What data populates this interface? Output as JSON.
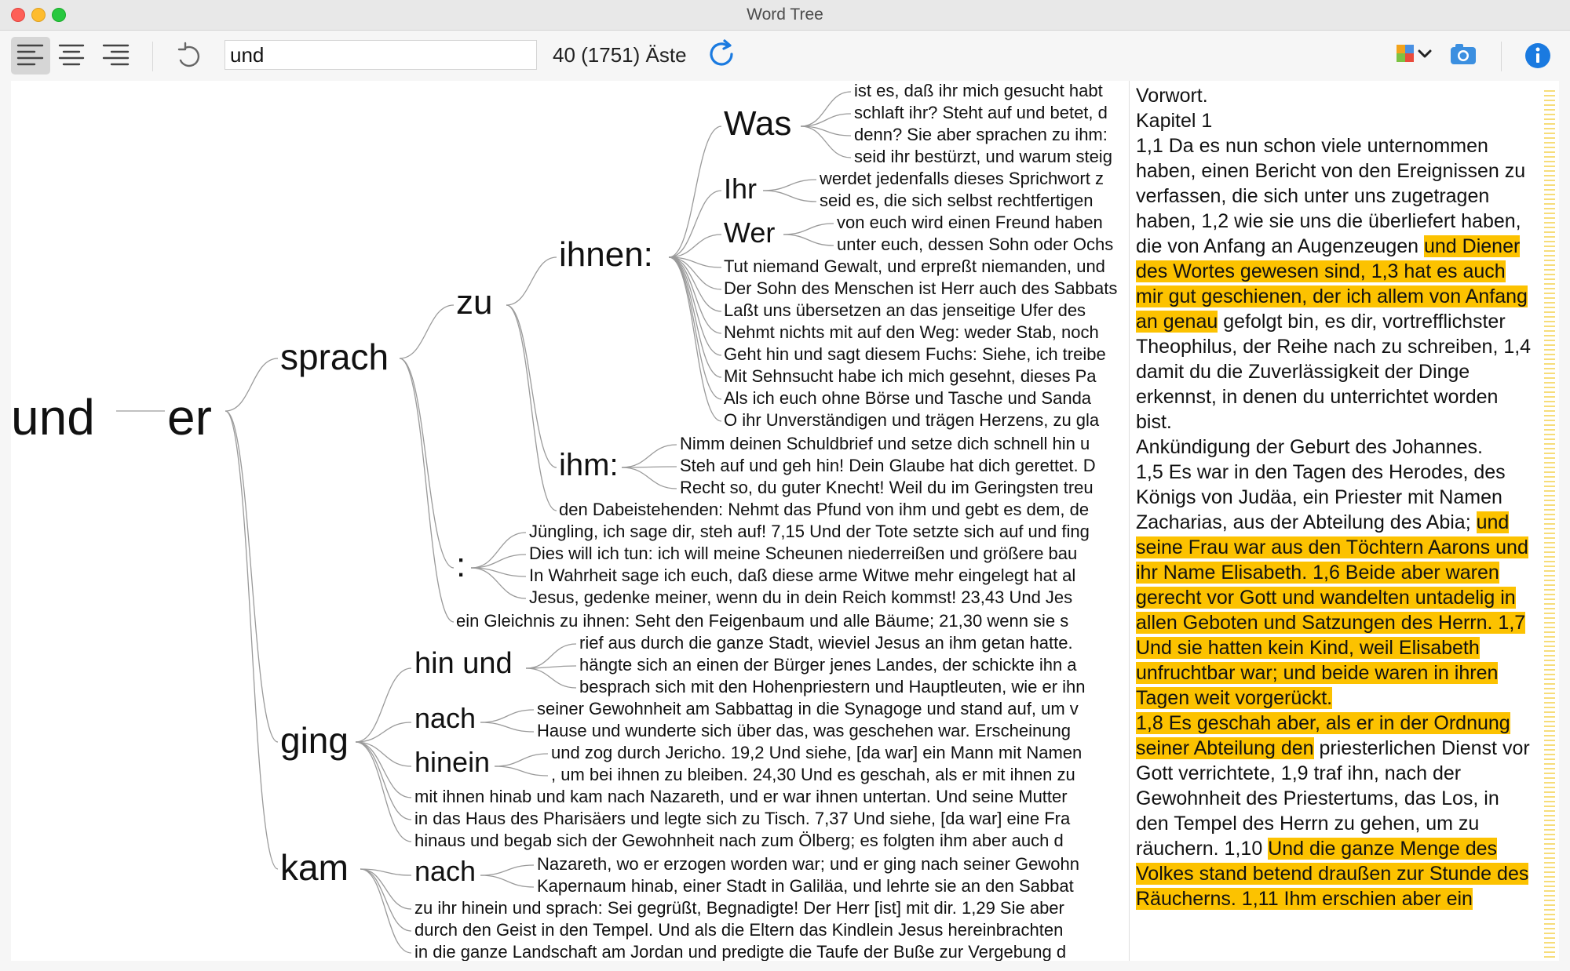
{
  "window": {
    "title": "Word Tree"
  },
  "toolbar": {
    "search_value": "und",
    "search_placeholder": "",
    "branches_label": "40 (1751) Äste",
    "icons": [
      "align-left-icon",
      "align-center-icon",
      "align-right-icon",
      "undo-icon",
      "refresh-icon",
      "plugin-icon",
      "chevron-down-icon",
      "camera-icon",
      "info-icon"
    ],
    "accent_color": "#1a7ae0"
  },
  "tree": {
    "root": "und",
    "level1": "er",
    "sprach": "sprach",
    "ging": "ging",
    "kam": "kam",
    "zu": "zu",
    "colon": ":",
    "ihnen": "ihnen:",
    "ihm": "ihm:",
    "was": "Was",
    "ihr": "Ihr",
    "wer": "Wer",
    "hin_und": "hin und",
    "nach_ging": "nach",
    "hinein": "hinein",
    "nach_kam": "nach",
    "leaves_was": [
      "ist es, daß ihr mich gesucht habt",
      "schlaft ihr? Steht auf und betet, d",
      "denn? Sie aber sprachen zu ihm:",
      "seid ihr bestürzt, und warum steig"
    ],
    "leaves_ihr": [
      "werdet jedenfalls dieses Sprichwort z",
      "seid es, die sich selbst rechtfertigen"
    ],
    "leaves_wer": [
      "von euch wird einen Freund haben",
      "unter euch, dessen Sohn oder Ochs"
    ],
    "leaves_ihnen": [
      "Tut niemand Gewalt, und erpreßt niemanden, und",
      "Der Sohn des Menschen ist Herr auch des Sabbats",
      "Laßt uns übersetzen an das jenseitige Ufer des",
      "Nehmt nichts mit auf den Weg: weder Stab, noch",
      "Geht hin und sagt diesem Fuchs: Siehe, ich treibe",
      "Mit Sehnsucht habe ich mich gesehnt, dieses Pa",
      "Als ich euch ohne Börse und Tasche und Sanda",
      "O ihr Unverständigen und trägen Herzens, zu gla"
    ],
    "leaves_ihm": [
      "Nimm deinen Schuldbrief und setze dich schnell hin u",
      "Steh auf und geh hin! Dein Glaube hat dich gerettet. D",
      "Recht so, du guter Knecht! Weil du im Geringsten treu"
    ],
    "leaf_dabei": "den Dabeistehenden: Nehmt das Pfund von ihm und gebt es dem, de",
    "leaves_colon": [
      "Jüngling, ich sage dir, steh auf! 7,15 Und der Tote setzte sich auf und fing",
      "Dies will ich tun: ich will meine Scheunen niederreißen und größere bau",
      "In Wahrheit sage ich euch, daß diese arme Witwe mehr eingelegt hat al",
      "Jesus, gedenke meiner, wenn du in dein Reich kommst! 23,43 Und Jes"
    ],
    "leaf_gleichnis": "ein Gleichnis zu ihnen: Seht den Feigenbaum und alle Bäume; 21,30 wenn sie s",
    "leaves_hin_und": [
      "rief aus durch die ganze Stadt, wieviel Jesus an ihm getan hatte.",
      "hängte sich an einen der Bürger jenes Landes, der schickte ihn a",
      "besprach sich mit den Hohenpriestern und Hauptleuten, wie er ihn"
    ],
    "leaves_nach_ging": [
      "seiner Gewohnheit am Sabbattag in die Synagoge und stand auf, um v",
      "Hause und wunderte sich über das, was geschehen war. Erscheinung"
    ],
    "leaves_hinein": [
      "und zog durch Jericho. 19,2 Und siehe, [da war] ein Mann mit Namen",
      ", um bei ihnen zu bleiben. 24,30 Und es geschah, als er mit ihnen zu"
    ],
    "leaves_ging": [
      "mit ihnen hinab und kam nach Nazareth, und er war ihnen untertan. Und seine Mutter",
      "in das Haus des Pharisäers und legte sich zu Tisch. 7,37 Und siehe, [da war] eine Fra",
      "hinaus und begab sich der Gewohnheit nach zum Ölberg; es folgten ihm aber auch d"
    ],
    "leaves_nach_kam": [
      "Nazareth, wo er erzogen worden war; und er ging nach seiner Gewohn",
      "Kapernaum hinab, einer Stadt in Galiläa, und lehrte sie an den Sabbat"
    ],
    "leaves_kam": [
      "zu ihr hinein und sprach: Sei gegrüßt, Begnadigte! Der Herr [ist] mit dir. 1,29 Sie aber",
      "durch den Geist in den Tempel. Und als die Eltern das Kindlein Jesus hereinbrachten",
      "in die ganze Landschaft am Jordan und predigte die Taufe der Buße zur Vergebung d"
    ]
  },
  "reader": {
    "highlight_color": "#fcc200",
    "segments": [
      {
        "t": "Vorwort.",
        "h": false,
        "br": true
      },
      {
        "t": "Kapitel 1",
        "h": false,
        "br": true
      },
      {
        "t": "1,1 Da es nun schon viele unternommen haben, einen Bericht von den Ereignissen zu verfassen, die sich unter uns zugetragen haben, 1,2 wie sie uns die überliefert haben, die von Anfang an Augenzeugen ",
        "h": false
      },
      {
        "t": "und Diener des Wortes gewesen sind, 1,3 hat es auch mir gut geschienen, der ich allem von Anfang an genau",
        "h": true
      },
      {
        "t": " gefolgt bin, es dir, vortrefflichster Theophilus, der Reihe nach zu schreiben, 1,4 damit du die Zuverlässigkeit der Dinge erkennst, in denen du unterrichtet worden bist.",
        "h": false,
        "br": true
      },
      {
        "t": "Ankündigung der Geburt des Johannes.",
        "h": false,
        "br": true
      },
      {
        "t": "1,5 Es war in den Tagen des Herodes, des Königs von Judäa, ein Priester mit Namen Zacharias, aus der Abteilung des Abia; ",
        "h": false
      },
      {
        "t": "und seine Frau war aus den Töchtern Aarons und ihr Name Elisabeth. 1,6 Beide aber waren gerecht vor Gott und wandelten untadelig in allen Geboten und Satzungen des Herrn. 1,7 Und sie hatten kein Kind, weil Elisabeth unfruchtbar war; und beide waren in ihren Tagen weit vorgerückt. ",
        "h": true,
        "br": true
      },
      {
        "t": "1,8 Es geschah aber, als er in der Ordnung seiner Abteilung den",
        "h": true
      },
      {
        "t": " priesterlichen Dienst vor Gott verrichtete, 1,9 traf ihn, nach der Gewohnheit des Priestertums, das Los, in den Tempel des Herrn zu gehen, um zu räuchern. 1,10 ",
        "h": false
      },
      {
        "t": "Und die ganze Menge des Volkes stand betend draußen zur Stunde des Räucherns. 1,11 Ihm erschien aber ein",
        "h": true
      }
    ]
  }
}
